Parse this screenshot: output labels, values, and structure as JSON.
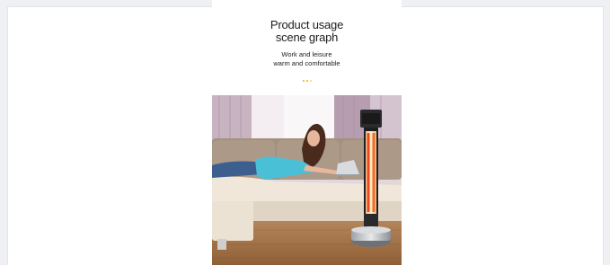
{
  "section": {
    "title_line1": "Product usage",
    "title_line2": "scene graph",
    "subtitle_line1": "Work and leisure",
    "subtitle_line2": "warm and comfortable"
  },
  "colors": {
    "accent": "#f2a516",
    "page_background": "#eef0f3",
    "card_background": "#ffffff"
  },
  "photo": {
    "subject": "woman on sofa with laptop next to standing infrared heater"
  }
}
